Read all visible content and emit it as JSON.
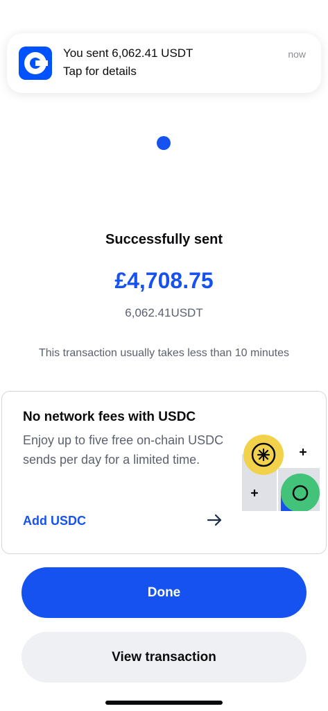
{
  "notification": {
    "app_icon": "coinbase-logo-icon",
    "title": "You sent 6,062.41 USDT",
    "subtitle": "Tap for details",
    "time": "now"
  },
  "status": {
    "indicator_icon": "progress-dot-icon",
    "message": "Successfully sent",
    "fiat_amount": "£4,708.75",
    "crypto_amount": "6,062.41USDT",
    "note": "This transaction usually takes less than 10 minutes"
  },
  "promo": {
    "title": "No network fees with USDC",
    "body": "Enjoy up to five free on-chain USDC sends per day for a limited time.",
    "link": "Add USDC",
    "arrow_icon": "arrow-right-icon",
    "illustration_icon": "usdc-promo-illustration"
  },
  "actions": {
    "done": "Done",
    "view_transaction": "View transaction"
  },
  "colors": {
    "accent": "#1652f0",
    "brand": "#0052ff",
    "secondary_button": "#eef0f3",
    "muted_text": "#5b616e"
  }
}
